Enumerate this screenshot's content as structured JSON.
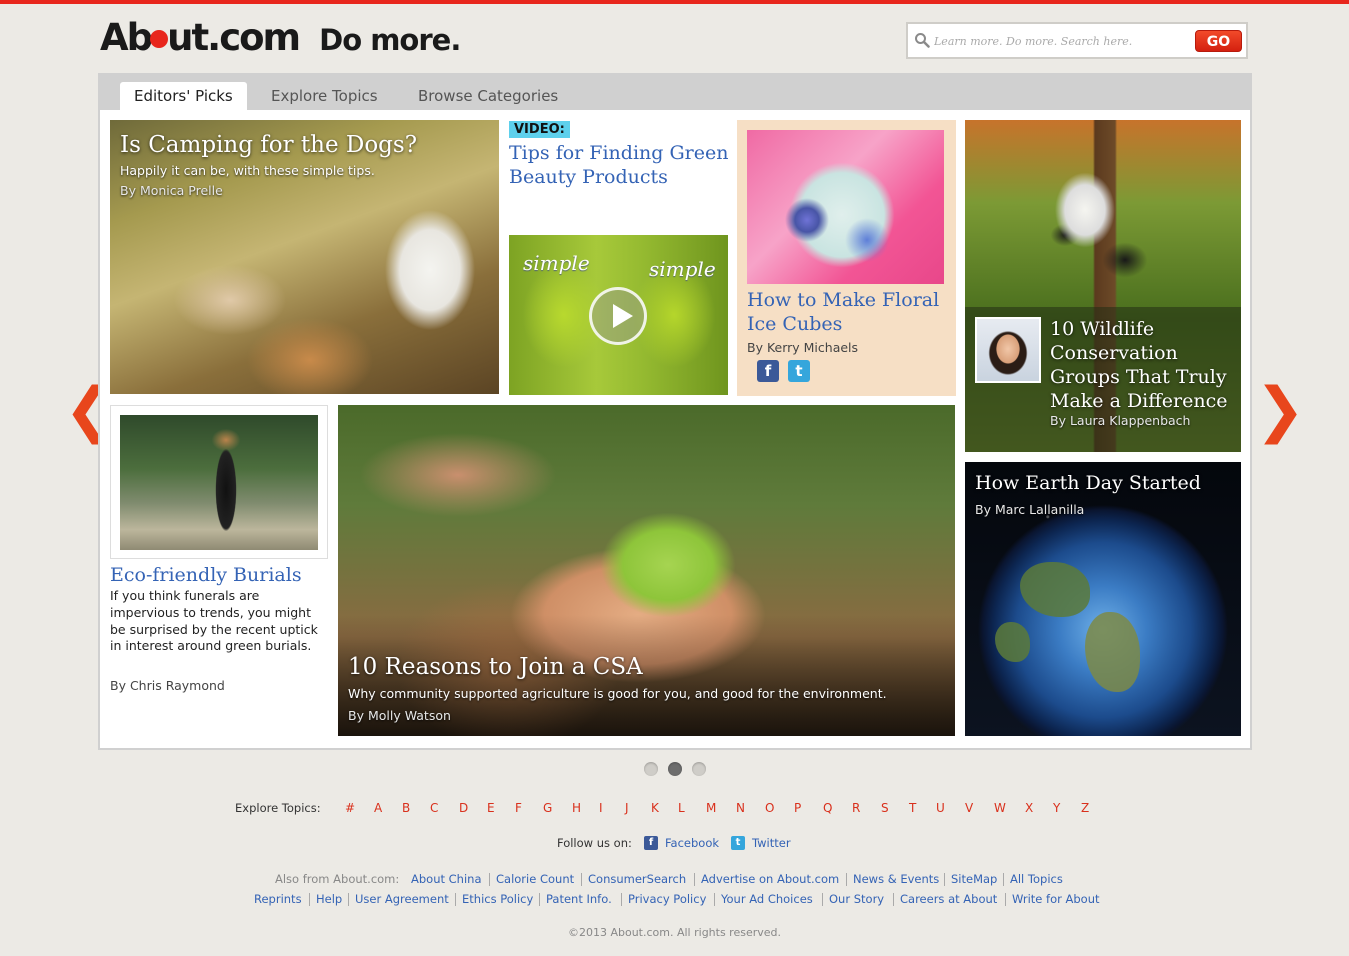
{
  "header": {
    "logo_text_a": "Ab",
    "logo_text_b": "ut.com",
    "tagline": "Do more.",
    "search_placeholder": "Learn more. Do more. Search here.",
    "go_label": "GO"
  },
  "tabs": [
    {
      "label": "Editors' Picks",
      "active": true
    },
    {
      "label": "Explore Topics",
      "active": false
    },
    {
      "label": "Browse Categories",
      "active": false
    }
  ],
  "cards": {
    "camping": {
      "title": "Is Camping for the Dogs?",
      "subtitle": "Happily it can be, with these simple tips.",
      "byline": "By Monica Prelle"
    },
    "video": {
      "tag": "VIDEO:",
      "title": "Tips for Finding Green Beauty Products",
      "product_left": "simple",
      "product_right": "simple"
    },
    "floral": {
      "title": "How to Make Floral Ice Cubes",
      "byline": "By Kerry Michaels"
    },
    "wildlife": {
      "title": "10 Wildlife Conservation Groups That Truly Make a Difference",
      "byline": "By Laura Klappenbach"
    },
    "burials": {
      "title": "Eco-friendly Burials",
      "text": "If you think funerals are impervious to trends, you might be surprised by the recent uptick in interest around green burials.",
      "byline": "By Chris Raymond"
    },
    "csa": {
      "title": "10 Reasons to Join a CSA",
      "subtitle": "Why community supported agriculture is good for you, and good for the environment.",
      "byline": "By Molly Watson"
    },
    "earth": {
      "title": "How Earth Day Started",
      "byline": "By Marc Lallanilla"
    }
  },
  "carousel": {
    "prev": "❮",
    "next": "❯",
    "pages": 3,
    "active_page": 2
  },
  "footer": {
    "explore_label": "Explore Topics:",
    "letters": [
      "#",
      "A",
      "B",
      "C",
      "D",
      "E",
      "F",
      "G",
      "H",
      "I",
      "J",
      "K",
      "L",
      "M",
      "N",
      "O",
      "P",
      "Q",
      "R",
      "S",
      "T",
      "U",
      "V",
      "W",
      "X",
      "Y",
      "Z"
    ],
    "follow_label": "Follow us on:",
    "facebook": "Facebook",
    "twitter": "Twitter",
    "also_label": "Also from About.com:",
    "links_row1": [
      "About China",
      "Calorie Count",
      "ConsumerSearch",
      "Advertise on About.com",
      "News & Events",
      "SiteMap",
      "All Topics"
    ],
    "links_row2": [
      "Reprints",
      "Help",
      "User Agreement",
      "Ethics Policy",
      "Patent Info.",
      "Privacy Policy",
      "Your Ad Choices",
      "Our Story",
      "Careers at About",
      "Write for About"
    ],
    "copyright": "©2013 About.com. All rights reserved."
  },
  "colors": {
    "accent": "#e8261c",
    "link": "#3463b5",
    "video_tag": "#5ed0ec"
  },
  "icons": [
    "search-icon",
    "play-icon",
    "facebook-icon",
    "twitter-icon",
    "prev-arrow-icon",
    "next-arrow-icon"
  ]
}
